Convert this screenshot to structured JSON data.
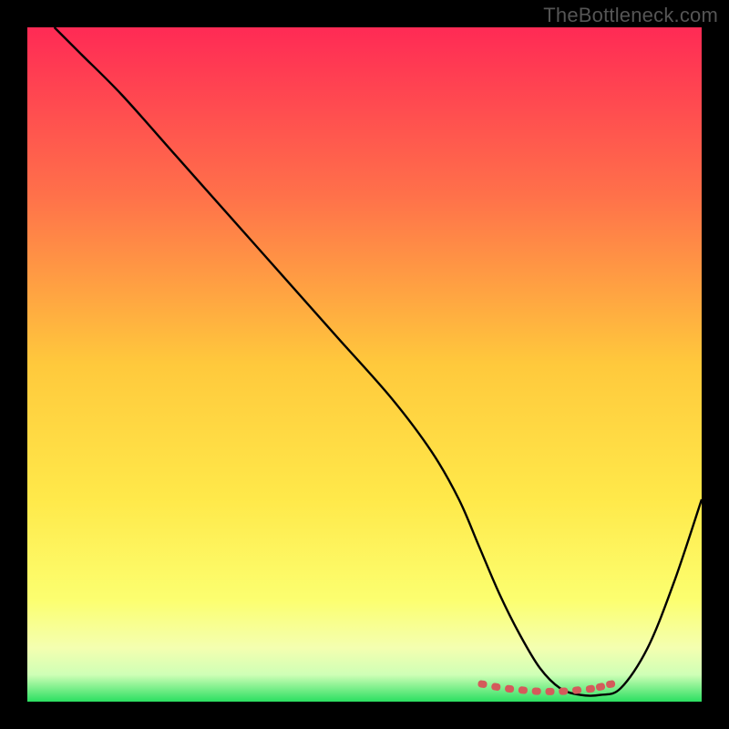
{
  "watermark": "TheBottleneck.com",
  "colors": {
    "page_bg": "#000000",
    "curve": "#000000",
    "markers": "#d45b5b"
  },
  "chart_data": {
    "type": "line",
    "title": "",
    "xlabel": "",
    "ylabel": "",
    "xlim": [
      0,
      100
    ],
    "ylim": [
      0,
      100
    ],
    "gradient_stops": [
      {
        "offset": 0.0,
        "color": "#ff2a55"
      },
      {
        "offset": 0.25,
        "color": "#ff714a"
      },
      {
        "offset": 0.5,
        "color": "#ffc93c"
      },
      {
        "offset": 0.7,
        "color": "#ffe94a"
      },
      {
        "offset": 0.85,
        "color": "#fcff70"
      },
      {
        "offset": 0.92,
        "color": "#f4ffb0"
      },
      {
        "offset": 0.96,
        "color": "#cfffb6"
      },
      {
        "offset": 1.0,
        "color": "#2bdf61"
      }
    ],
    "series": [
      {
        "name": "bottleneck-curve",
        "x": [
          4,
          8,
          14,
          22,
          30,
          38,
          46,
          54,
          60,
          64,
          67,
          70,
          73,
          76,
          79,
          82,
          85,
          88,
          92,
          96,
          100
        ],
        "y": [
          100,
          96,
          90,
          81,
          72,
          63,
          54,
          45,
          37,
          30,
          23,
          16,
          10,
          5,
          2,
          1,
          1,
          2,
          8,
          18,
          30
        ]
      }
    ],
    "trough_markers": {
      "name": "min-region",
      "x": [
        67.5,
        69.5,
        71.5,
        73.5,
        75.5,
        77.5,
        79.5,
        81.5,
        83.5,
        85.0,
        86.5
      ],
      "y": [
        2.6,
        2.2,
        1.9,
        1.7,
        1.55,
        1.5,
        1.55,
        1.7,
        1.9,
        2.2,
        2.6
      ]
    }
  }
}
